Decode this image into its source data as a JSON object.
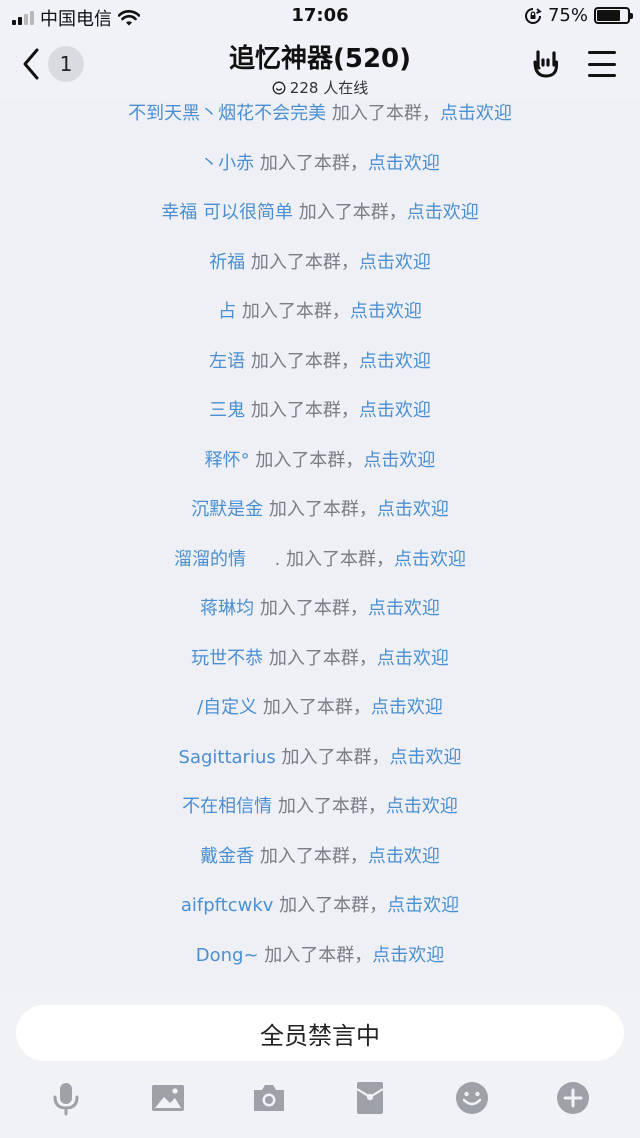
{
  "status_bar": {
    "carrier": "中国电信",
    "time": "17:06",
    "battery": "75%",
    "battery_level": 0.75
  },
  "nav": {
    "unread_count": "1",
    "title": "追忆神器(520)",
    "online_text": "228 人在线"
  },
  "messages": [
    {
      "name": "不到天黑丶烟花不会完美",
      "text": " 加入了本群，",
      "link": "点击欢迎"
    },
    {
      "name": "丶小赤",
      "text": " 加入了本群，",
      "link": "点击欢迎"
    },
    {
      "name": "幸福 可以很简单",
      "text": " 加入了本群，",
      "link": "点击欢迎"
    },
    {
      "name": "祈福",
      "text": " 加入了本群，",
      "link": "点击欢迎"
    },
    {
      "name": "占",
      "text": " 加入了本群，",
      "link": "点击欢迎"
    },
    {
      "name": "左语",
      "text": " 加入了本群，",
      "link": "点击欢迎"
    },
    {
      "name": "三鬼",
      "text": " 加入了本群，",
      "link": "点击欢迎"
    },
    {
      "name": "释怀°",
      "text": " 加入了本群，",
      "link": "点击欢迎"
    },
    {
      "name": "沉默是金",
      "text": " 加入了本群，",
      "link": "点击欢迎"
    },
    {
      "name": "溜溜的情",
      "text": "     . 加入了本群，",
      "link": "点击欢迎"
    },
    {
      "name": "蒋琳均",
      "text": " 加入了本群，",
      "link": "点击欢迎"
    },
    {
      "name": "玩世不恭",
      "text": " 加入了本群，",
      "link": "点击欢迎"
    },
    {
      "name": "/自定义",
      "text": " 加入了本群，",
      "link": "点击欢迎"
    },
    {
      "name": "Sagittarius",
      "text": " 加入了本群，",
      "link": "点击欢迎"
    },
    {
      "name": "不在相信情",
      "text": " 加入了本群，",
      "link": "点击欢迎"
    },
    {
      "name": "戴金香",
      "text": " 加入了本群，",
      "link": "点击欢迎"
    },
    {
      "name": "aifpftcwkv",
      "text": " 加入了本群，",
      "link": "点击欢迎"
    },
    {
      "name": "Dong~",
      "text": " 加入了本群，",
      "link": "点击欢迎"
    }
  ],
  "bottom": {
    "muted_label": "全员禁言中"
  },
  "toolbar_icons": [
    "microphone-icon",
    "image-icon",
    "camera-icon",
    "red-packet-icon",
    "emoji-icon",
    "plus-icon"
  ],
  "colors": {
    "name_blue": "#4b8fd2",
    "system_gray": "#7a7d84",
    "icon_gray": "#9ea1a8"
  }
}
